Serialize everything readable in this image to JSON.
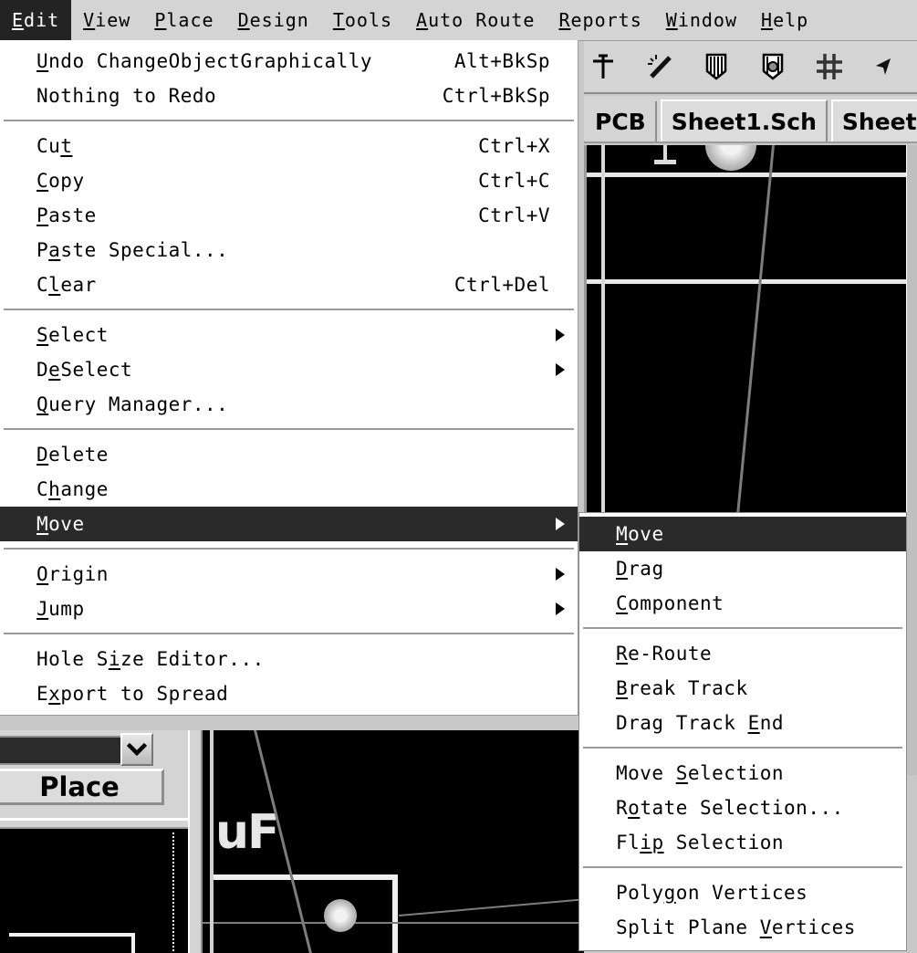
{
  "menubar": {
    "items": [
      {
        "label": "Edit",
        "mnemonic": "E",
        "active": true
      },
      {
        "label": "View",
        "mnemonic": "V",
        "active": false
      },
      {
        "label": "Place",
        "mnemonic": "P",
        "active": false
      },
      {
        "label": "Design",
        "mnemonic": "D",
        "active": false
      },
      {
        "label": "Tools",
        "mnemonic": "T",
        "active": false
      },
      {
        "label": "Auto Route",
        "mnemonic": "A",
        "active": false
      },
      {
        "label": "Reports",
        "mnemonic": "R",
        "active": false
      },
      {
        "label": "Window",
        "mnemonic": "W",
        "active": false
      },
      {
        "label": "Help",
        "mnemonic": "H",
        "active": false
      }
    ]
  },
  "toolbar": {
    "icons": [
      "crosshair-place-icon",
      "magic-wand-icon",
      "layer-stack-icon",
      "layer-stack-edit-icon",
      "grid-icon",
      "arrow-cursor-icon"
    ]
  },
  "tabs": [
    {
      "label": "PCB",
      "active": false
    },
    {
      "label": "Sheet1.Sch",
      "active": true
    },
    {
      "label": "Sheet",
      "active": false
    }
  ],
  "edit_menu": {
    "title": "Edit",
    "groups": [
      [
        {
          "label": "Undo  ChangeObjectGraphically",
          "mnemonic": "U",
          "accel": "Alt+BkSp",
          "submenu": false,
          "selected": false
        },
        {
          "label": "Nothing to Redo",
          "mnemonic": "",
          "accel": "Ctrl+BkSp",
          "submenu": false,
          "selected": false
        }
      ],
      [
        {
          "label": "Cut",
          "mnemonic": "t",
          "accel": "Ctrl+X",
          "submenu": false,
          "selected": false
        },
        {
          "label": "Copy",
          "mnemonic": "C",
          "accel": "Ctrl+C",
          "submenu": false,
          "selected": false
        },
        {
          "label": "Paste",
          "mnemonic": "P",
          "accel": "Ctrl+V",
          "submenu": false,
          "selected": false
        },
        {
          "label": "Paste Special...",
          "mnemonic": "a",
          "accel": "",
          "submenu": false,
          "selected": false
        },
        {
          "label": "Clear",
          "mnemonic": "l",
          "accel": "Ctrl+Del",
          "submenu": false,
          "selected": false
        }
      ],
      [
        {
          "label": "Select",
          "mnemonic": "S",
          "accel": "",
          "submenu": true,
          "selected": false
        },
        {
          "label": "DeSelect",
          "mnemonic": "e",
          "accel": "",
          "submenu": true,
          "selected": false
        },
        {
          "label": "Query Manager...",
          "mnemonic": "Q",
          "accel": "",
          "submenu": false,
          "selected": false
        }
      ],
      [
        {
          "label": "Delete",
          "mnemonic": "D",
          "accel": "",
          "submenu": false,
          "selected": false
        },
        {
          "label": "Change",
          "mnemonic": "h",
          "accel": "",
          "submenu": false,
          "selected": false
        },
        {
          "label": "Move",
          "mnemonic": "M",
          "accel": "",
          "submenu": true,
          "selected": true
        }
      ],
      [
        {
          "label": "Origin",
          "mnemonic": "O",
          "accel": "",
          "submenu": true,
          "selected": false
        },
        {
          "label": "Jump",
          "mnemonic": "J",
          "accel": "",
          "submenu": true,
          "selected": false
        }
      ],
      [
        {
          "label": "Hole Size Editor...",
          "mnemonic": "i",
          "accel": "",
          "submenu": false,
          "selected": false
        },
        {
          "label": "Export to Spread",
          "mnemonic": "x",
          "accel": "",
          "submenu": false,
          "selected": false
        }
      ]
    ]
  },
  "move_submenu": {
    "title": "Move",
    "groups": [
      [
        {
          "label": "Move",
          "mnemonic": "M",
          "accel": "",
          "submenu": false,
          "selected": true
        },
        {
          "label": "Drag",
          "mnemonic": "D",
          "accel": "",
          "submenu": false,
          "selected": false
        },
        {
          "label": "Component",
          "mnemonic": "C",
          "accel": "",
          "submenu": false,
          "selected": false
        }
      ],
      [
        {
          "label": "Re-Route",
          "mnemonic": "R",
          "accel": "",
          "submenu": false,
          "selected": false
        },
        {
          "label": "Break Track",
          "mnemonic": "B",
          "accel": "",
          "submenu": false,
          "selected": false
        },
        {
          "label": "Drag Track End",
          "mnemonic": "E",
          "accel": "",
          "submenu": false,
          "selected": false
        }
      ],
      [
        {
          "label": "Move Selection",
          "mnemonic": "S",
          "accel": "",
          "submenu": false,
          "selected": false
        },
        {
          "label": "Rotate Selection...",
          "mnemonic": "o",
          "accel": "",
          "submenu": false,
          "selected": false
        },
        {
          "label": "Flip Selection",
          "mnemonic": "ip",
          "accel": "",
          "submenu": false,
          "selected": false
        }
      ],
      [
        {
          "label": "Polygon Vertices",
          "mnemonic": "g",
          "accel": "",
          "submenu": false,
          "selected": false
        },
        {
          "label": "Split Plane Vertices",
          "mnemonic": "V",
          "accel": "",
          "submenu": false,
          "selected": false
        }
      ]
    ]
  },
  "left_panel": {
    "combo_value": "",
    "place_label": "Place"
  },
  "canvas": {
    "component_label": "uF",
    "background": "#000000",
    "line_color": "#e8e8e8",
    "trace_color": "#7d7d7d"
  },
  "colors": {
    "chrome": "#d4d4d4",
    "menu_bg": "#ffffff",
    "highlight": "#2a2a2a",
    "highlight_text": "#ffffff",
    "separator": "#9a9a9a"
  }
}
